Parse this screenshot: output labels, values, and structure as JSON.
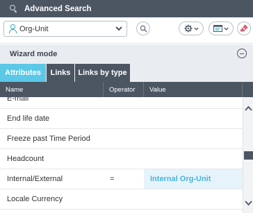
{
  "window": {
    "title": "Advanced Search"
  },
  "toolbar": {
    "object_type": "Org-Unit"
  },
  "wizard": {
    "label": "Wizard mode"
  },
  "tabs": [
    {
      "label": "Attributes",
      "active": true
    },
    {
      "label": "Links",
      "active": false
    },
    {
      "label": "Links by type",
      "active": false
    }
  ],
  "table": {
    "columns": [
      "Name",
      "Operator",
      "Value"
    ],
    "rows": [
      {
        "name": "E-mail",
        "operator": "",
        "value": ""
      },
      {
        "name": "End life date",
        "operator": "",
        "value": ""
      },
      {
        "name": "Freeze past Time Period",
        "operator": "",
        "value": ""
      },
      {
        "name": "Headcount",
        "operator": "",
        "value": ""
      },
      {
        "name": "Internal/External",
        "operator": "=",
        "value": "Internal Org-Unit"
      },
      {
        "name": "Locale Currency",
        "operator": "",
        "value": ""
      }
    ]
  },
  "colors": {
    "header": "#4c5663",
    "active_tab": "#5bc8e7",
    "value_text": "#45b5de",
    "value_bg": "#e6f3fa"
  },
  "icons": [
    "search-icon",
    "org-unit-icon",
    "chevron-down-icon",
    "magnifier-icon",
    "gear-icon",
    "view-icon",
    "eraser-icon",
    "collapse-icon",
    "scroll-up-icon",
    "scroll-down-icon"
  ]
}
